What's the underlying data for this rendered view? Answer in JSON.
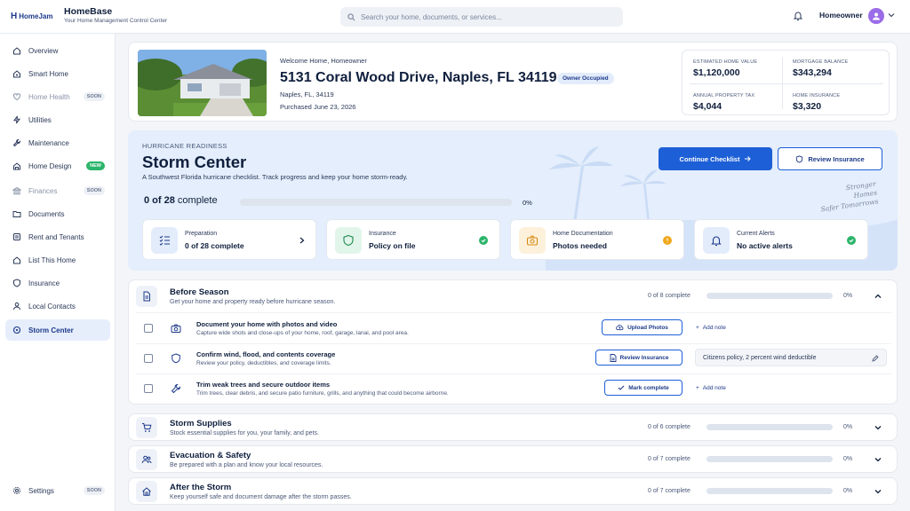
{
  "header": {
    "logo_text": "HomeJam",
    "app_name": "HomeBase",
    "app_tagline": "Your Home Management Control Center",
    "search_placeholder": "Search your home, documents, or services...",
    "user_name": "Homeowner"
  },
  "sidebar": {
    "items": [
      {
        "label": "Overview",
        "icon": "home-icon"
      },
      {
        "label": "Smart Home",
        "icon": "smart-home-icon"
      },
      {
        "label": "Home Health",
        "icon": "heart-icon",
        "badge": "SOON"
      },
      {
        "label": "Utilities",
        "icon": "bolt-icon"
      },
      {
        "label": "Maintenance",
        "icon": "wrench-icon"
      },
      {
        "label": "Home Design",
        "icon": "design-icon",
        "badge": "NEW"
      },
      {
        "label": "Finances",
        "icon": "bank-icon",
        "badge": "SOON"
      },
      {
        "label": "Documents",
        "icon": "folder-icon"
      },
      {
        "label": "Rent and Tenants",
        "icon": "list-icon"
      },
      {
        "label": "List This Home",
        "icon": "house-listing-icon"
      },
      {
        "label": "Insurance",
        "icon": "shield-icon"
      },
      {
        "label": "Local Contacts",
        "icon": "person-icon"
      },
      {
        "label": "Storm Center",
        "icon": "storm-icon"
      }
    ],
    "settings_label": "Settings",
    "settings_badge": "SOON"
  },
  "property": {
    "welcome": "Welcome Home, Homeowner",
    "address": "5131 Coral Wood Drive, Naples, FL 34119",
    "status_badge": "Owner Occupied",
    "city": "Naples, FL, 34119",
    "purchased": "Purchased June 23, 2026",
    "stats": [
      {
        "label": "ESTIMATED HOME VALUE",
        "value": "$1,120,000"
      },
      {
        "label": "MORTGAGE BALANCE",
        "value": "$343,294"
      },
      {
        "label": "ANNUAL PROPERTY TAX",
        "value": "$4,044"
      },
      {
        "label": "HOME INSURANCE",
        "value": "$3,320"
      }
    ]
  },
  "storm": {
    "eyebrow": "HURRICANE READINESS",
    "title": "Storm Center",
    "subtitle": "A Southwest Florida hurricane checklist. Track progress and keep your home storm-ready.",
    "progress_count": "0 of 28",
    "progress_suffix": "complete",
    "progress_pct": "0%",
    "progress_value": 0,
    "continue_label": "Continue Checklist",
    "review_label": "Review Insurance",
    "tagline": [
      "Stronger",
      "Homes",
      "Safer Tomorrows"
    ],
    "cards": [
      {
        "title": "Preparation",
        "value": "0 of 28 complete",
        "icon": "checklist-icon"
      },
      {
        "title": "Insurance",
        "value": "Policy on file",
        "icon": "shield-icon",
        "status_color": "#2bb56b"
      },
      {
        "title": "Home Documentation",
        "value": "Photos needed",
        "icon": "camera-icon",
        "status_color": "#f0a81c"
      },
      {
        "title": "Current Alerts",
        "value": "No active alerts",
        "icon": "bell-icon",
        "status_color": "#2bb56b"
      }
    ]
  },
  "sections": [
    {
      "title": "Before Season",
      "subtitle": "Get your home and property ready before hurricane season.",
      "count": "0 of 8 complete",
      "pct": "0%",
      "expanded": true,
      "tasks": [
        {
          "title": "Document your home with photos and video",
          "desc": "Capture wide shots and close-ups of your home, roof, garage, lanai, and pool area.",
          "action": "Upload Photos",
          "note_action": "Add note"
        },
        {
          "title": "Confirm wind, flood, and contents coverage",
          "desc": "Review your policy, deductibles, and coverage limits.",
          "action": "Review Insurance",
          "note_value": "Citizens policy, 2 percent wind deductible"
        },
        {
          "title": "Trim weak trees and secure outdoor items",
          "desc": "Trim trees, clear debris, and secure patio furniture, grills, and anything that could become airborne.",
          "action": "Mark complete",
          "note_action": "Add note"
        }
      ]
    },
    {
      "title": "Storm Supplies",
      "subtitle": "Stock essential supplies for you, your family, and pets.",
      "count": "0 of 6 complete",
      "pct": "0%"
    },
    {
      "title": "Evacuation & Safety",
      "subtitle": "Be prepared with a plan and know your local resources.",
      "count": "0 of 7 complete",
      "pct": "0%"
    },
    {
      "title": "After the Storm",
      "subtitle": "Keep yourself safe and document damage after the storm passes.",
      "count": "0 of 7 complete",
      "pct": "0%"
    }
  ],
  "colors": {
    "primary": "#1d5fd6",
    "success": "#2bb56b",
    "warning": "#f0a81c",
    "avatar": "#9b6ce8"
  }
}
